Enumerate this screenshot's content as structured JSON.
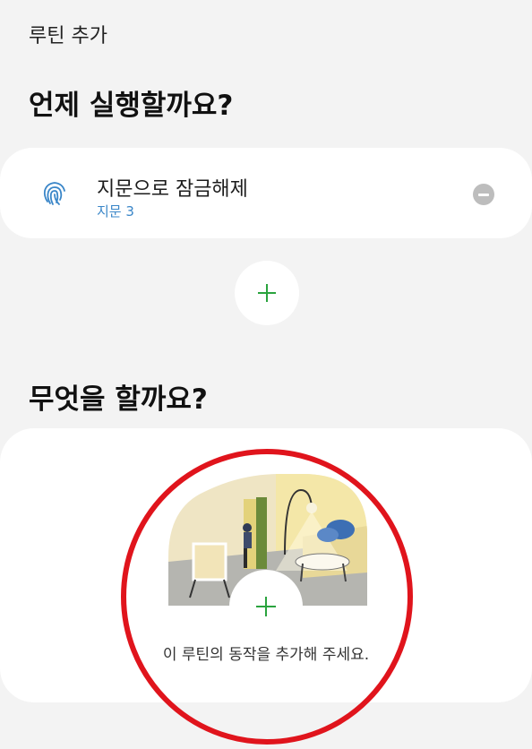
{
  "header": {
    "title": "루틴 추가"
  },
  "when": {
    "title": "언제 실행할까요?",
    "trigger": {
      "name": "지문으로 잠금해제",
      "detail": "지문 3"
    }
  },
  "what": {
    "title": "무엇을 할까요?",
    "hint": "이 루틴의 동작을 추가해 주세요."
  },
  "icons": {
    "trigger_icon": "fingerprint-icon",
    "remove": "minus-circle-icon",
    "add": "plus-icon"
  },
  "colors": {
    "accent_green": "#2aa33e",
    "detail_blue": "#3a86c8",
    "annotation_red": "#e0141c"
  }
}
